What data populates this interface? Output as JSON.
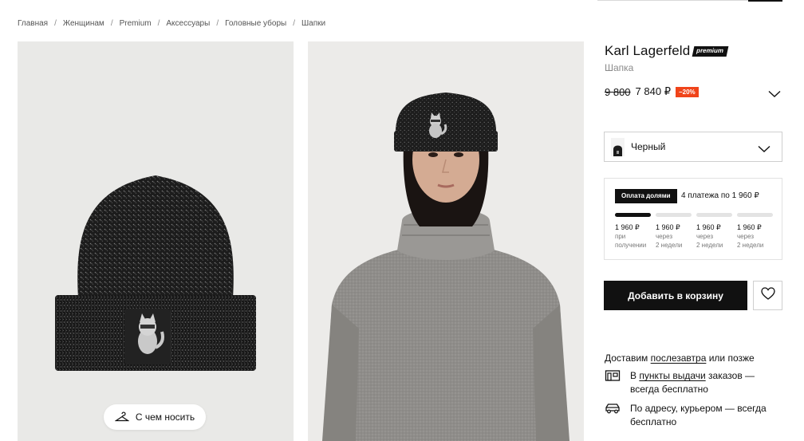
{
  "breadcrumb": [
    "Главная",
    "Женщинам",
    "Premium",
    "Аксессуары",
    "Головные уборы",
    "Шапки"
  ],
  "gallery": {
    "wear_button": "С чем носить"
  },
  "product": {
    "brand": "Karl Lagerfeld",
    "badge": "premium",
    "type": "Шапка",
    "old_price": "9 800",
    "new_price": "7 840 ₽",
    "discount": "−20%"
  },
  "color_select": {
    "value": "Черный"
  },
  "split_payment": {
    "badge": "Оплата долями",
    "summary": "4 платежа по 1 960 ₽",
    "installments": [
      {
        "amount": "1 960 ₽",
        "when_1": "при",
        "when_2": "получении",
        "active": true
      },
      {
        "amount": "1 960 ₽",
        "when_1": "через",
        "when_2": "2 недели",
        "active": false
      },
      {
        "amount": "1 960 ₽",
        "when_1": "через",
        "when_2": "2 недели",
        "active": false
      },
      {
        "amount": "1 960 ₽",
        "when_1": "через",
        "when_2": "2 недели",
        "active": false
      }
    ]
  },
  "actions": {
    "add_to_cart": "Добавить в корзину"
  },
  "delivery": {
    "head_prefix": "Доставим",
    "head_link": "послезавтра",
    "head_suffix": "или позже",
    "pickup_prefix": "В",
    "pickup_link": "пункты выдачи",
    "pickup_suffix": "заказов — всегда бесплатно",
    "courier": "По адресу, курьером — всегда бесплатно"
  },
  "colors": {
    "accent_discount": "#f0441a",
    "primary_button": "#111111",
    "hat": "#1b1b1b",
    "sweater": "#8e8c89"
  },
  "icons": [
    "hanger-icon",
    "chevron-down-icon",
    "heart-icon",
    "pickup-point-icon",
    "courier-car-icon"
  ]
}
